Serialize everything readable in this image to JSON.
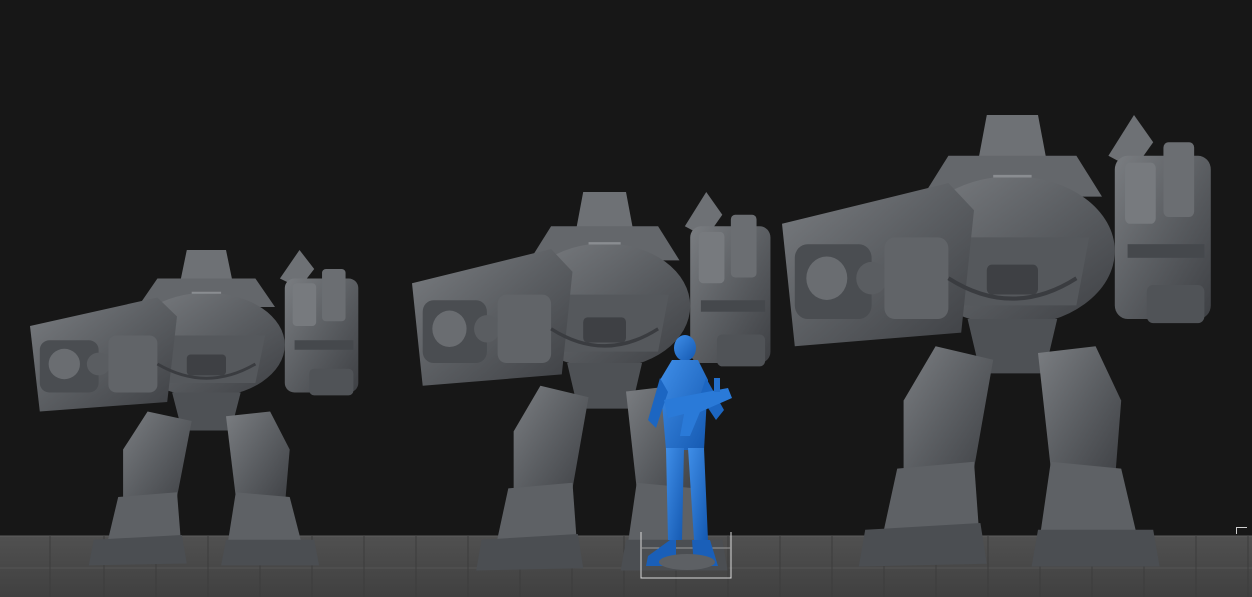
{
  "app": {
    "view": "3d-viewport",
    "background_color": "#171717",
    "grid_color": "#4a4a4a",
    "grid_line_color": "#5a5a5a"
  },
  "models": [
    {
      "name": "mech-small",
      "color": "#5b5e62",
      "selected": false
    },
    {
      "name": "mech-medium",
      "color": "#5b5e62",
      "selected": false
    },
    {
      "name": "mech-large",
      "color": "#5b5e62",
      "selected": false
    },
    {
      "name": "human-figure-with-rifle",
      "color": "#1a6fd0",
      "selected": true
    }
  ],
  "icons": {
    "cursor": "cursor-corner-icon"
  }
}
